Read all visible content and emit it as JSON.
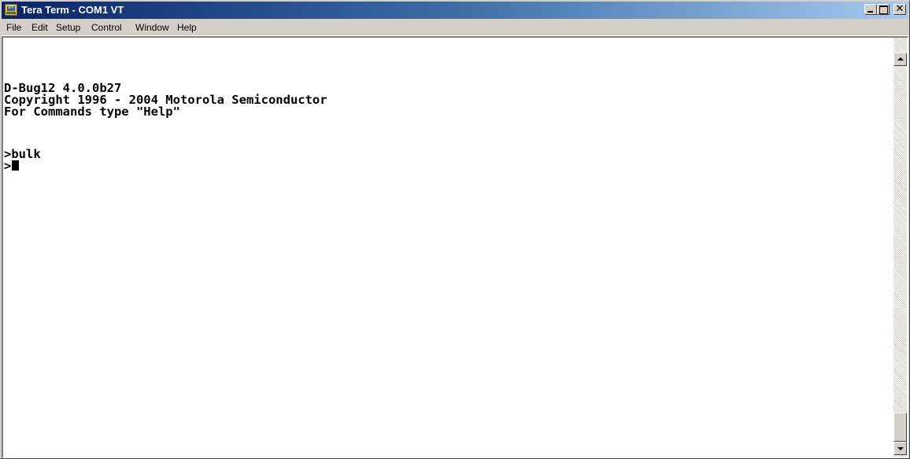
{
  "window": {
    "title": "Tera Term - COM1 VT",
    "icon": "tera-term-app-icon",
    "icon_text": "VT",
    "title_gradient": [
      "#0a246a",
      "#a6caf0"
    ]
  },
  "caption_buttons": {
    "minimize": "minimize-icon",
    "maximize": "maximize-icon",
    "close_glyph": "✕"
  },
  "menu": {
    "items": [
      "File",
      "Edit",
      "Setup",
      "Control",
      "Window",
      "Help"
    ]
  },
  "terminal": {
    "lines": [
      "D-Bug12 4.0.0b27",
      "Copyright 1996 - 2004 Motorola Semiconductor",
      "For Commands type \"Help\"",
      "",
      ">bulk",
      ">"
    ],
    "background": "#ffffff",
    "foreground": "#000000"
  },
  "scrollbar": {
    "position_fraction": 1.0
  }
}
